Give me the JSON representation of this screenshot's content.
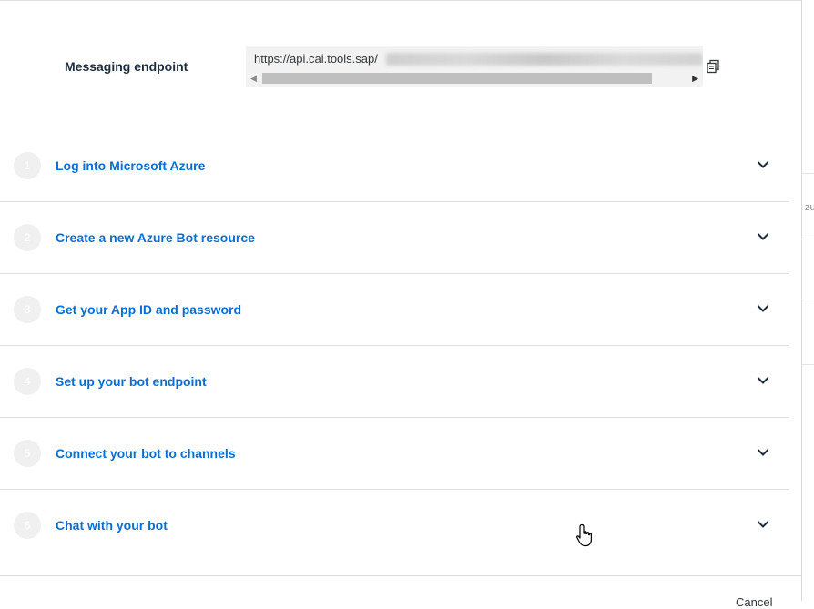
{
  "endpoint": {
    "label": "Messaging endpoint",
    "url": "https://api.cai.tools.sap/"
  },
  "steps": [
    {
      "number": "1",
      "title": "Log into Microsoft Azure"
    },
    {
      "number": "2",
      "title": "Create a new Azure Bot resource"
    },
    {
      "number": "3",
      "title": "Get your App ID and password"
    },
    {
      "number": "4",
      "title": "Set up your bot endpoint"
    },
    {
      "number": "5",
      "title": "Connect your bot to channels"
    },
    {
      "number": "6",
      "title": "Chat with your bot"
    }
  ],
  "footer": {
    "cancel_label": "Cancel"
  },
  "backdrop": {
    "fragment": "zu"
  },
  "colors": {
    "link": "#0a6ed1",
    "step_circle": "#f0f0f0"
  }
}
